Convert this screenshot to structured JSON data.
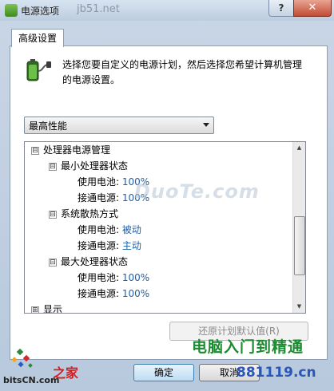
{
  "window": {
    "title": "电源选项",
    "help_glyph": "?",
    "close_glyph": "✕"
  },
  "watermarks": {
    "top": "jb51.net",
    "center": "DuoTe.com",
    "brand_cn": "电脑入门到精通",
    "site": "881119.cn",
    "bits": "bitsCN.com",
    "home": "之家"
  },
  "tab": {
    "label": "高级设置"
  },
  "intro": {
    "text": "选择您要自定义的电源计划，然后选择您希望计算机管理的电源设置。"
  },
  "plan_select": {
    "value": "最高性能"
  },
  "tree": {
    "rows": [
      {
        "expander": "⊟",
        "label": "处理器电源管理",
        "value": ""
      },
      {
        "expander": "⊟",
        "label": "最小处理器状态",
        "value": ""
      },
      {
        "expander": "",
        "label": "使用电池: ",
        "value": "100%"
      },
      {
        "expander": "",
        "label": "接通电源: ",
        "value": "100%"
      },
      {
        "expander": "⊟",
        "label": "系统散热方式",
        "value": ""
      },
      {
        "expander": "",
        "label": "使用电池: ",
        "value": "被动"
      },
      {
        "expander": "",
        "label": "接通电源: ",
        "value": "主动"
      },
      {
        "expander": "⊟",
        "label": "最大处理器状态",
        "value": ""
      },
      {
        "expander": "",
        "label": "使用电池: ",
        "value": "100%"
      },
      {
        "expander": "",
        "label": "接通电源: ",
        "value": "100%"
      },
      {
        "expander": "⊞",
        "label": "显示",
        "value": ""
      }
    ],
    "scroll_up": "▲",
    "scroll_down": "▼"
  },
  "buttons": {
    "restore": "还原计划默认值(R)",
    "ok": "确定",
    "cancel": "取消"
  },
  "colors": {
    "value_link": "#1f5fa8",
    "accent_green": "#1b8a31"
  }
}
